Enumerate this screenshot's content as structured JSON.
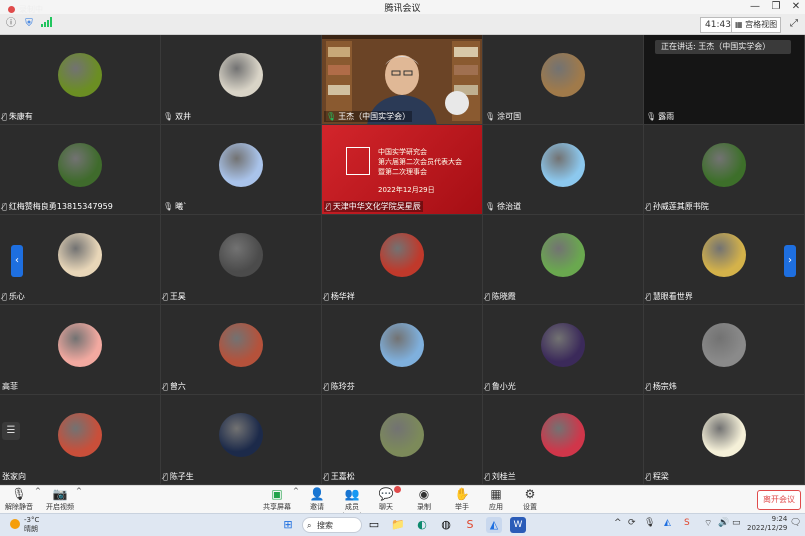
{
  "window": {
    "title": "腾讯会议",
    "min": "—",
    "restore": "❐",
    "close": "✕"
  },
  "topbar": {
    "timer": "41:43",
    "view_label": "宫格视图"
  },
  "meeting": {
    "recording_label": "录制中",
    "speaking_label": "正在讲话: 王杰（中国实学会）",
    "participants": [
      {
        "name": "朱康有",
        "mic": "muted",
        "avatar": "#6b8e23"
      },
      {
        "name": "双井",
        "mic": "off",
        "avatar": "#d9d4c7"
      },
      {
        "name": "王杰（中国实学会）",
        "mic": "on",
        "avatar": "video"
      },
      {
        "name": "涂可国",
        "mic": "off",
        "avatar": "#a07a4a"
      },
      {
        "name": "露雨",
        "mic": "off",
        "avatar": "none"
      },
      {
        "name": "红梅赞梅良勇13815347959",
        "mic": "muted",
        "avatar": "#3f6b2c"
      },
      {
        "name": "曦`",
        "mic": "off",
        "avatar": "#a9c3ea"
      },
      {
        "name": "天津中华文化学院吴星辰",
        "mic": "muted",
        "avatar": "slide"
      },
      {
        "name": "徐治道",
        "mic": "off",
        "avatar": "#8cc8ee"
      },
      {
        "name": "孙威莲其原书院",
        "mic": "muted",
        "avatar": "#3d6f2a"
      },
      {
        "name": "乐心",
        "mic": "muted",
        "avatar": "#e8d6b8"
      },
      {
        "name": "王昊",
        "mic": "muted",
        "avatar": "#4b4b4b"
      },
      {
        "name": "杨华祥",
        "mic": "muted",
        "avatar": "#c0392b"
      },
      {
        "name": "陈晓霞",
        "mic": "muted",
        "avatar": "#6aa84f"
      },
      {
        "name": "慧眼看世界",
        "mic": "muted",
        "avatar": "#d4b24a"
      },
      {
        "name": "高菲",
        "mic": "none",
        "avatar": "#f2a9a0"
      },
      {
        "name": "曾六",
        "mic": "muted",
        "avatar": "#b5523b"
      },
      {
        "name": "陈玲芬",
        "mic": "muted",
        "avatar": "#7fb0dd"
      },
      {
        "name": "鲁小光",
        "mic": "muted",
        "avatar": "#3b2a5a"
      },
      {
        "name": "杨宗炜",
        "mic": "muted",
        "avatar": "#8a8a8a"
      },
      {
        "name": "张家向",
        "mic": "none",
        "avatar": "#c94f3a"
      },
      {
        "name": "陈子生",
        "mic": "muted",
        "avatar": "#1c2a4a"
      },
      {
        "name": "王嘉松",
        "mic": "muted",
        "avatar": "#7c8a5a"
      },
      {
        "name": "刘桂兰",
        "mic": "muted",
        "avatar": "#d0364a"
      },
      {
        "name": "程梁",
        "mic": "muted",
        "avatar": "#f5f0d8"
      }
    ],
    "slide": {
      "line1": "中国实学研究会",
      "line2": "第六届第二次会员代表大会",
      "line3": "暨第二次理事会",
      "date": "2022年12月29日",
      "color": "#c8161d"
    }
  },
  "toolbar": {
    "unmute": "解除静音",
    "video": "开启视频",
    "share": "共享屏幕",
    "invite": "邀请",
    "members": "成员(99+)",
    "chat": "聊天",
    "record": "录制",
    "raise": "举手",
    "apps": "应用",
    "settings": "设置",
    "leave": "离开会议"
  },
  "taskbar": {
    "temp": "-3°C",
    "weather": "晴朗",
    "search": "搜索",
    "time": "9:24",
    "date": "2022/12/29"
  },
  "colors": {
    "accent": "#1e6fe0",
    "leave": "#e04b4b",
    "slide": "#c8161d"
  }
}
